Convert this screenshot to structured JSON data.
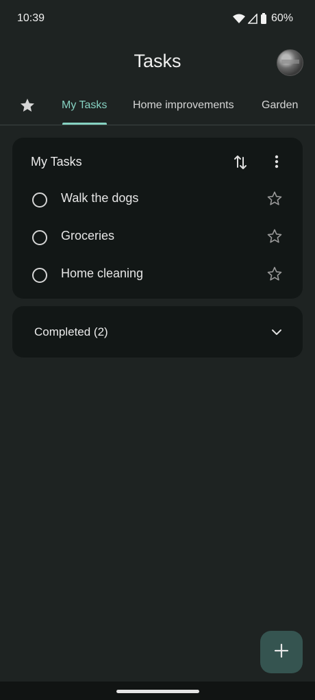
{
  "status_bar": {
    "time": "10:39",
    "battery": "60%"
  },
  "header": {
    "title": "Tasks"
  },
  "tabs": [
    {
      "label": "My Tasks",
      "active": true
    },
    {
      "label": "Home improvements",
      "active": false
    },
    {
      "label": "Garden",
      "active": false
    }
  ],
  "list_card": {
    "title": "My Tasks",
    "tasks": [
      {
        "label": "Walk the dogs"
      },
      {
        "label": "Groceries"
      },
      {
        "label": "Home cleaning"
      }
    ]
  },
  "completed": {
    "label": "Completed (2)"
  },
  "colors": {
    "accent": "#86d2c2",
    "background": "#1e2322",
    "card": "#121716",
    "fab": "#355450"
  },
  "icons": {
    "starred_tab": "star-icon",
    "sort": "sort-icon",
    "more": "more-vert-icon",
    "task_star": "star-outline-icon",
    "expand": "chevron-down-icon",
    "add": "plus-icon"
  }
}
